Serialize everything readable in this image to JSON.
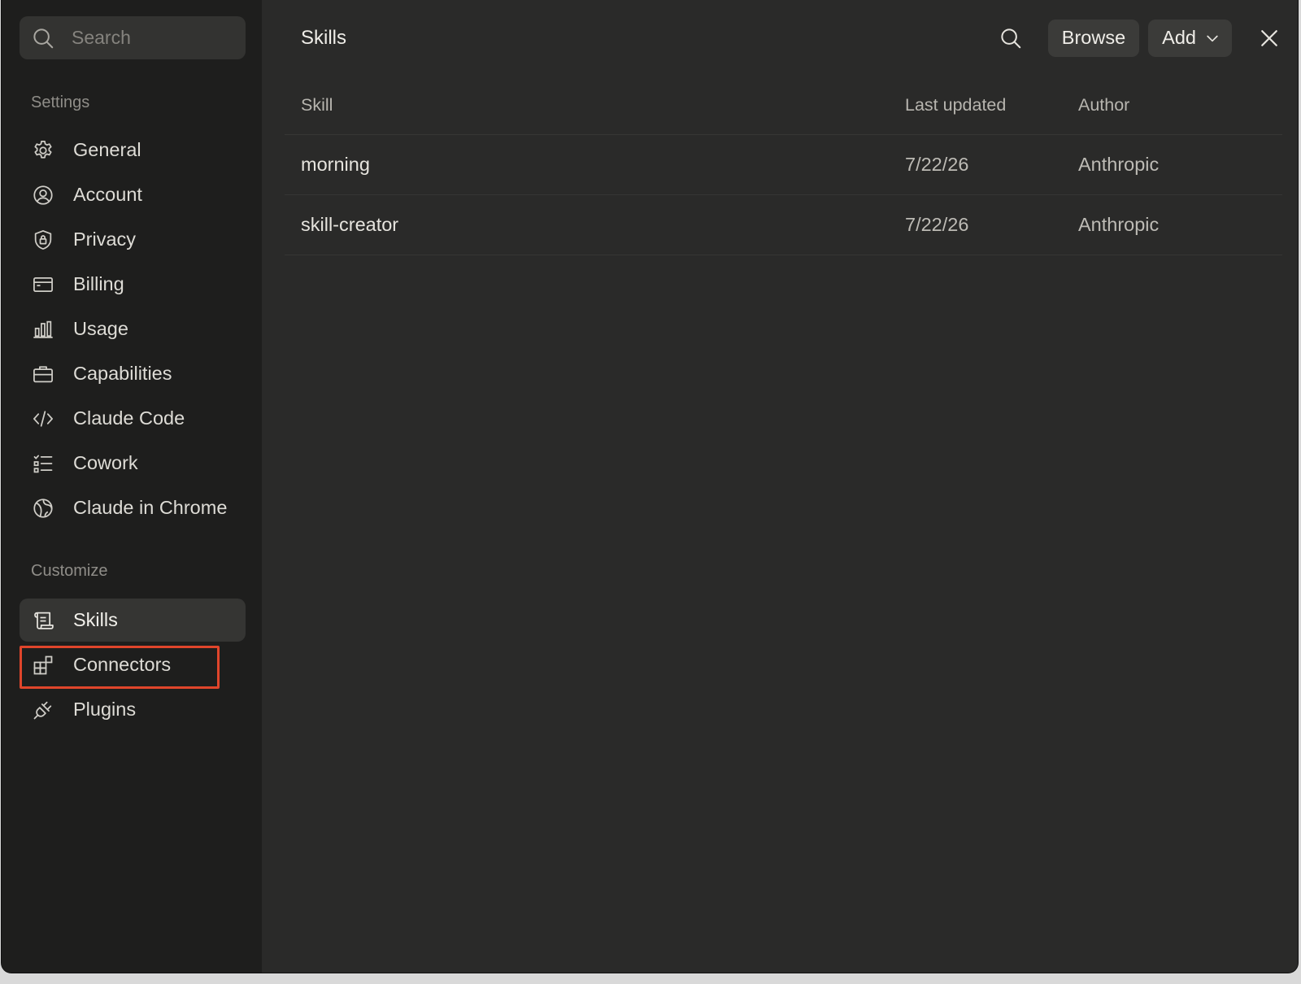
{
  "search": {
    "placeholder": "Search"
  },
  "sidebar": {
    "settings_title": "Settings",
    "settings_items": [
      {
        "label": "General",
        "icon": "gear-icon"
      },
      {
        "label": "Account",
        "icon": "user-circle-icon"
      },
      {
        "label": "Privacy",
        "icon": "shield-lock-icon"
      },
      {
        "label": "Billing",
        "icon": "credit-card-icon"
      },
      {
        "label": "Usage",
        "icon": "bar-chart-icon"
      },
      {
        "label": "Capabilities",
        "icon": "briefcase-icon"
      },
      {
        "label": "Claude Code",
        "icon": "code-icon"
      },
      {
        "label": "Cowork",
        "icon": "checklist-icon"
      },
      {
        "label": "Claude in Chrome",
        "icon": "globe-icon"
      }
    ],
    "customize_title": "Customize",
    "customize_items": [
      {
        "label": "Skills",
        "icon": "scroll-icon",
        "active": true
      },
      {
        "label": "Connectors",
        "icon": "connectors-icon",
        "highlighted": true
      },
      {
        "label": "Plugins",
        "icon": "plug-icon"
      }
    ]
  },
  "main": {
    "title": "Skills",
    "browse_label": "Browse",
    "add_label": "Add",
    "table": {
      "headers": [
        "Skill",
        "Last updated",
        "Author"
      ],
      "rows": [
        {
          "skill": "morning",
          "updated": "7/22/26",
          "author": "Anthropic"
        },
        {
          "skill": "skill-creator",
          "updated": "7/22/26",
          "author": "Anthropic"
        }
      ]
    }
  },
  "colors": {
    "sidebar_bg": "#1e1e1d",
    "main_bg": "#2a2a29",
    "active_item_bg": "#353533",
    "highlight_border": "#e0452b"
  }
}
